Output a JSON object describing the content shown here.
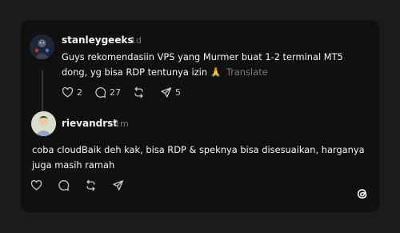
{
  "posts": [
    {
      "author": "stanleygeeks",
      "time": "1d",
      "text": "Guys rekomendasiin VPS yang Murmer buat 1-2 terminal MT5 dong, yg bisa RDP tentunya izin 🙏",
      "translate": "Translate",
      "likes": "2",
      "replies": "27",
      "reposts": "",
      "shares": "5"
    },
    {
      "author": "rievandrst",
      "time": "1m",
      "text": "coba cloudBaik deh kak, bisa RDP & speknya bisa disesuaikan, harganya juga masih ramah"
    }
  ],
  "icons": {
    "like": "heart-icon",
    "reply": "comment-icon",
    "repost": "repost-icon",
    "share": "send-icon",
    "brand": "threads-logo-icon"
  },
  "colors": {
    "background": "#1b1b1b",
    "card": "#101010",
    "text": "#f3f5f7",
    "muted": "#777777"
  }
}
